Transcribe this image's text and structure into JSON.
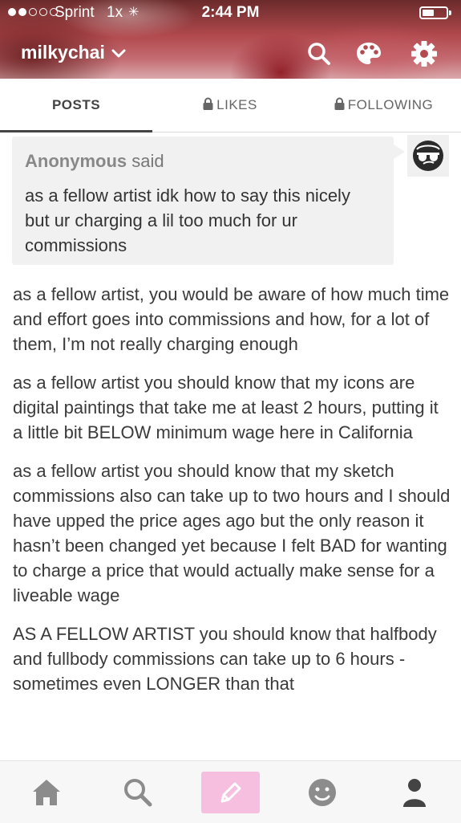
{
  "status_bar": {
    "carrier": "Sprint",
    "speed": "1x",
    "spinner": "✳",
    "time": "2:44 PM",
    "battery_level": 0.5
  },
  "header": {
    "blog_name": "milkychai",
    "chevron": "chevron-down-icon",
    "icons": [
      "search-icon",
      "palette-icon",
      "gear-icon"
    ]
  },
  "tabs": {
    "posts": "POSTS",
    "likes": "LIKES",
    "following": "FOLLOWING",
    "active": "posts"
  },
  "post": {
    "asker_name": "Anonymous",
    "asker_said": "said",
    "question": "as a fellow artist idk how to say this nicely but ur charging a lil too much for ur commissions",
    "answer_paragraphs": [
      "as a fellow artist, you would be aware of how much time and effort goes into commissions and how, for a lot of them, I’m not really charging enough",
      "as a fellow artist you should know that my icons are digital paintings that take me at least 2 hours, putting it a little bit BELOW minimum wage here in California",
      "as a fellow artist you should know that my sketch commissions also can take up to two hours and I should have upped the price ages ago but the only reason it hasn’t been changed yet because I felt BAD for wanting to charge a price that would actually make sense for a liveable wage",
      "AS A FELLOW ARTIST you should know that halfbody and fullbody commissions can take up to 6 hours - sometimes even LONGER than that"
    ]
  },
  "bottom_nav": {
    "items": [
      "home-icon",
      "search-icon",
      "compose-icon",
      "activity-icon",
      "account-icon"
    ],
    "accent_color": "#f6bedf"
  }
}
